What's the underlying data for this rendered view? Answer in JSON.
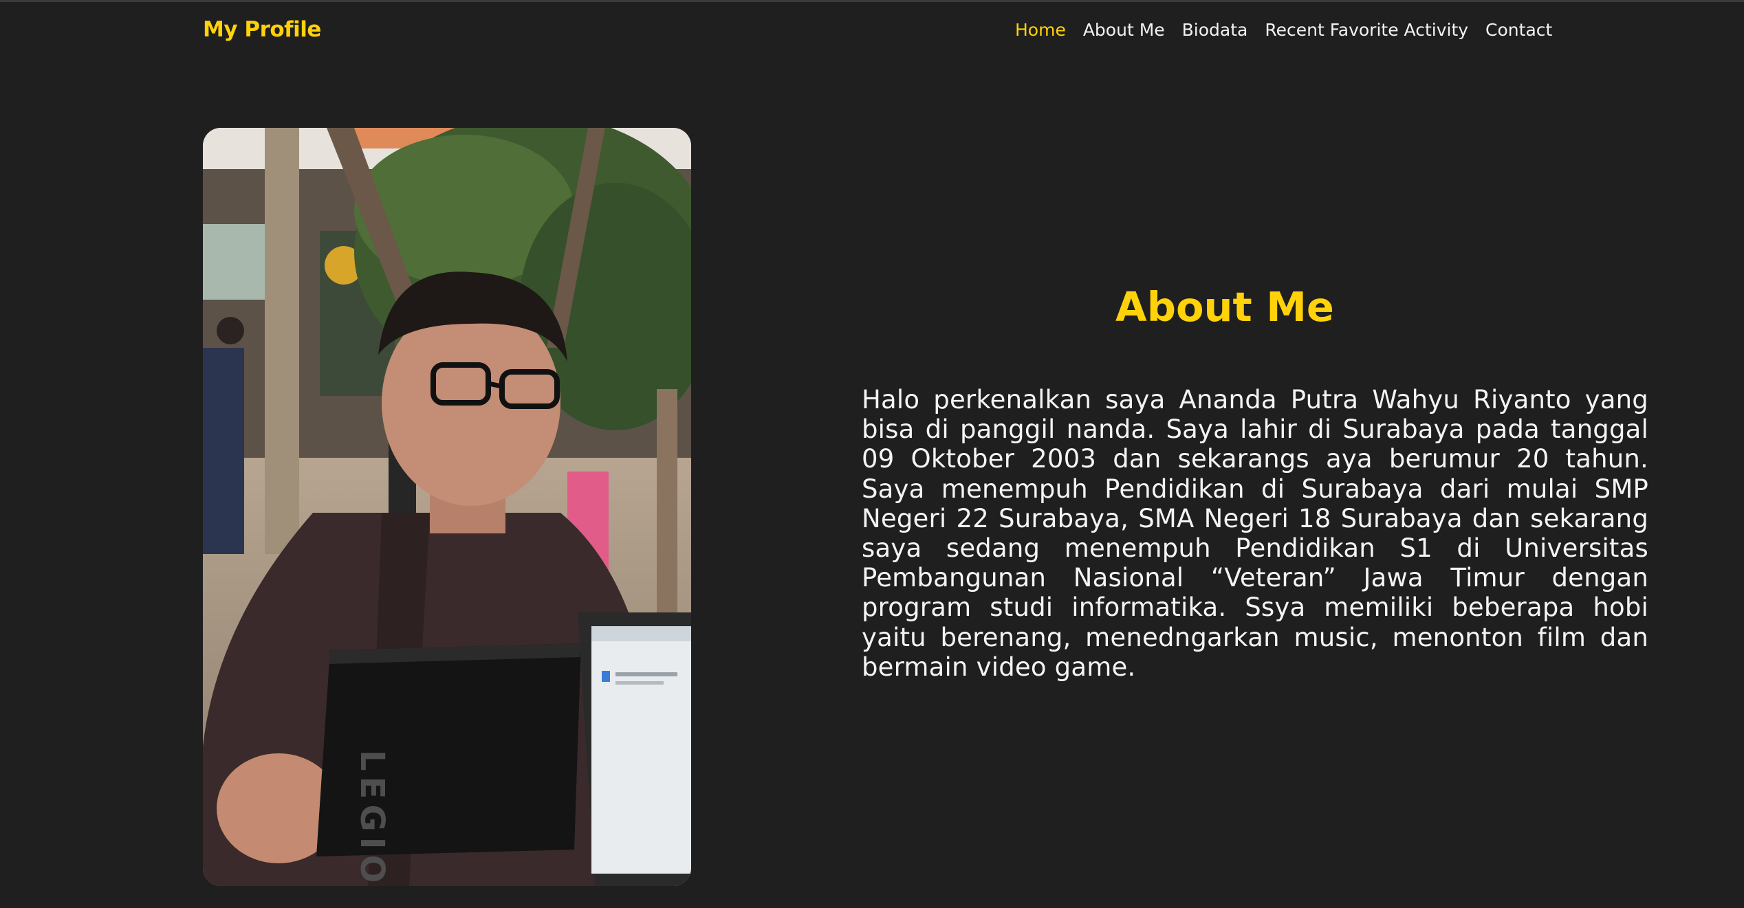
{
  "navbar": {
    "brand": "My Profile",
    "links": [
      "Home",
      "About Me",
      "Biodata",
      "Recent Favorite Activity",
      "Contact"
    ],
    "active_link": "Home"
  },
  "about": {
    "title": "About Me",
    "text": "Halo perkenalkan saya Ananda Putra Wahyu Riyanto yang bisa di panggil nanda. Saya lahir di Surabaya pada tanggal 09 Oktober 2003 dan sekarangs aya berumur 20 tahun. Saya menempuh Pendidikan di Surabaya dari mulai SMP Negeri 22 Surabaya, SMA Negeri 18 Surabaya dan sekarang saya sedang menempuh Pendidikan S1 di Universitas Pembangunan Nasional “Veteran” Jawa Timur dengan program studi informatika. Ssya memiliki beberapa hobi yaitu berenang, menedngarkan music, menonton film dan bermain video game."
  },
  "photo": {
    "laptop_brand": "LEGION"
  },
  "colors": {
    "background": "#1f1f1f",
    "accent": "#ffd20a",
    "text": "#f4f4f4"
  }
}
